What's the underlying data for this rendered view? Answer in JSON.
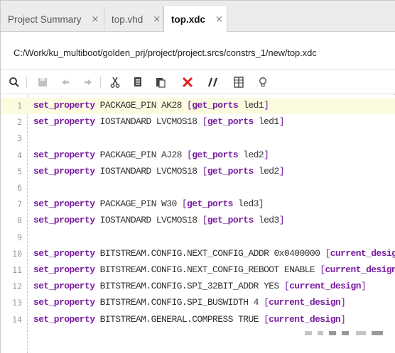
{
  "tabs": [
    {
      "label": "Project Summary",
      "active": false
    },
    {
      "label": "top.vhd",
      "active": false
    },
    {
      "label": "top.xdc",
      "active": true
    }
  ],
  "tab_close_glyph": "×",
  "file_path": "C:/Work/ku_multiboot/golden_prj/project/project.srcs/constrs_1/new/top.xdc",
  "toolbar": {
    "icons": [
      "search-icon",
      "save-icon",
      "undo-icon",
      "redo-icon",
      "cut-icon",
      "copy-icon",
      "paste-icon",
      "delete-icon",
      "comment-icon",
      "column-icon",
      "bulb-icon"
    ]
  },
  "colors": {
    "keyword": "#7a1ea1",
    "current_line": "#fbfbe0",
    "delete": "#e02020"
  },
  "lines": [
    {
      "num": "1",
      "kw": "set_property",
      "mid": " PACKAGE_PIN AK28 ",
      "open": "[",
      "cmd": "get_ports",
      "arg": " led1",
      "close": "]"
    },
    {
      "num": "2",
      "kw": "set_property",
      "mid": " IOSTANDARD LVCMOS18 ",
      "open": "[",
      "cmd": "get_ports",
      "arg": " led1",
      "close": "]"
    },
    {
      "num": "3",
      "kw": "",
      "mid": "",
      "open": "",
      "cmd": "",
      "arg": "",
      "close": ""
    },
    {
      "num": "4",
      "kw": "set_property",
      "mid": " PACKAGE_PIN AJ28 ",
      "open": "[",
      "cmd": "get_ports",
      "arg": " led2",
      "close": "]"
    },
    {
      "num": "5",
      "kw": "set_property",
      "mid": " IOSTANDARD LVCMOS18 ",
      "open": "[",
      "cmd": "get_ports",
      "arg": " led2",
      "close": "]"
    },
    {
      "num": "6",
      "kw": "",
      "mid": "",
      "open": "",
      "cmd": "",
      "arg": "",
      "close": ""
    },
    {
      "num": "7",
      "kw": "set_property",
      "mid": " PACKAGE_PIN W30 ",
      "open": "[",
      "cmd": "get_ports",
      "arg": " led3",
      "close": "]"
    },
    {
      "num": "8",
      "kw": "set_property",
      "mid": " IOSTANDARD LVCMOS18 ",
      "open": "[",
      "cmd": "get_ports",
      "arg": " led3",
      "close": "]"
    },
    {
      "num": "9",
      "kw": "",
      "mid": "",
      "open": "",
      "cmd": "",
      "arg": "",
      "close": ""
    },
    {
      "num": "10",
      "kw": "set_property",
      "mid": " BITSTREAM.CONFIG.NEXT_CONFIG_ADDR 0x0400000 ",
      "open": "[",
      "cmd": "current_design",
      "arg": "",
      "close": "]"
    },
    {
      "num": "11",
      "kw": "set_property",
      "mid": " BITSTREAM.CONFIG.NEXT_CONFIG_REBOOT ENABLE ",
      "open": "[",
      "cmd": "current_design",
      "arg": "",
      "close": "]"
    },
    {
      "num": "12",
      "kw": "set_property",
      "mid": " BITSTREAM.CONFIG.SPI_32BIT_ADDR YES ",
      "open": "[",
      "cmd": "current_design",
      "arg": "",
      "close": "]"
    },
    {
      "num": "13",
      "kw": "set_property",
      "mid": " BITSTREAM.CONFIG.SPI_BUSWIDTH 4 ",
      "open": "[",
      "cmd": "current_design",
      "arg": "",
      "close": "]"
    },
    {
      "num": "14",
      "kw": "set_property",
      "mid": " BITSTREAM.GENERAL.COMPRESS TRUE ",
      "open": "[",
      "cmd": "current_design",
      "arg": "",
      "close": "]"
    }
  ]
}
